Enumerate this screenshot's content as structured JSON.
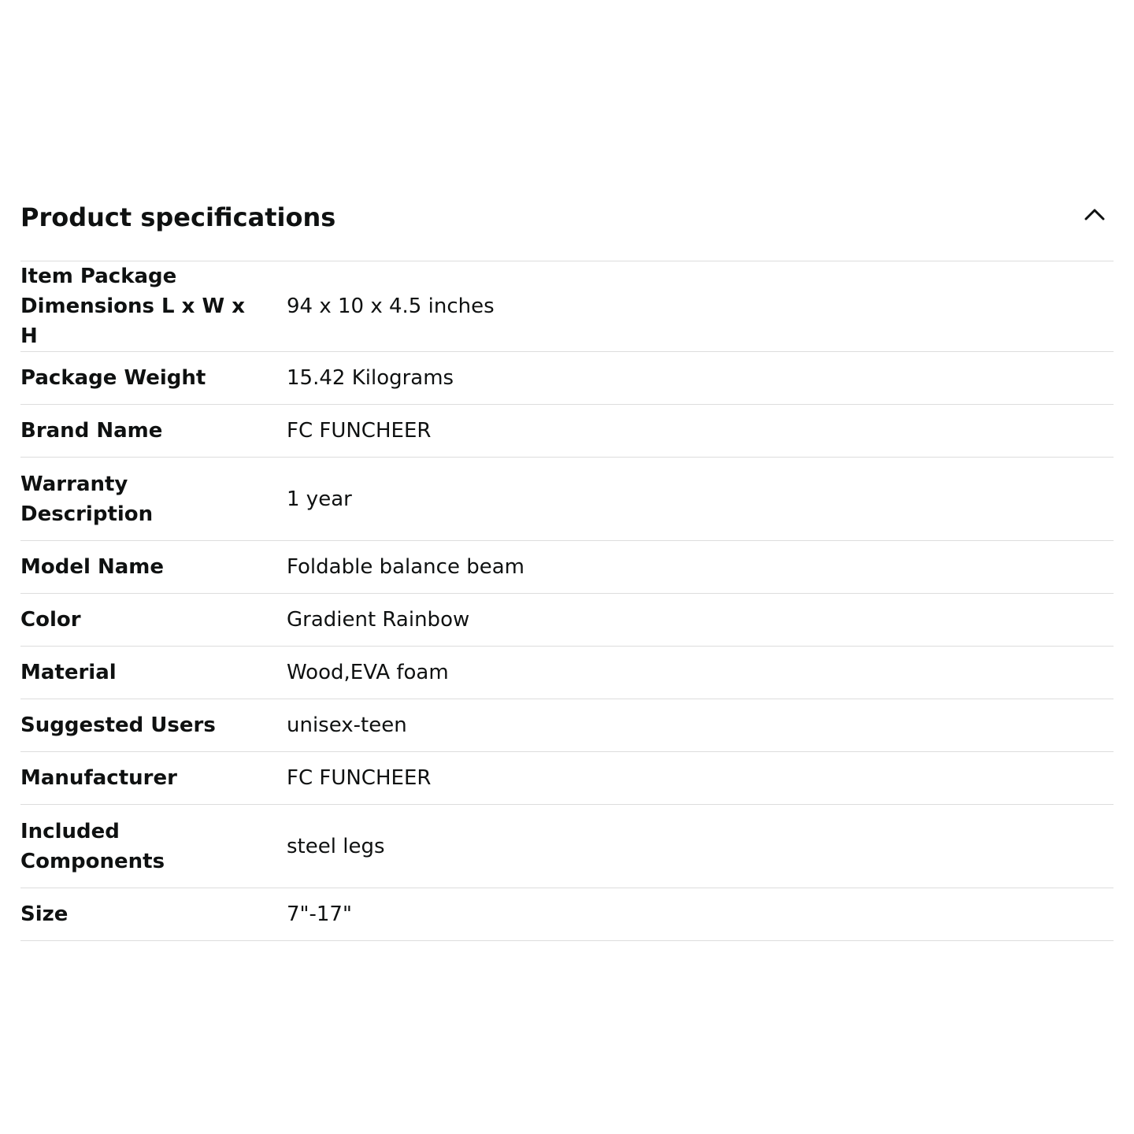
{
  "section": {
    "title": "Product specifications",
    "toggle_icon": "chevron-up-icon"
  },
  "specs": [
    {
      "label": "Item Package Dimensions L x W x H",
      "value": "94 x 10 x 4.5 inches"
    },
    {
      "label": "Package Weight",
      "value": "15.42 Kilograms"
    },
    {
      "label": "Brand Name",
      "value": "FC FUNCHEER"
    },
    {
      "label": "Warranty Description",
      "value": "1 year"
    },
    {
      "label": "Model Name",
      "value": "Foldable balance beam"
    },
    {
      "label": "Color",
      "value": "Gradient Rainbow"
    },
    {
      "label": "Material",
      "value": "Wood,EVA foam"
    },
    {
      "label": "Suggested Users",
      "value": "unisex-teen"
    },
    {
      "label": "Manufacturer",
      "value": "FC FUNCHEER"
    },
    {
      "label": "Included Components",
      "value": "steel legs"
    },
    {
      "label": "Size",
      "value": "7\"-17\""
    }
  ]
}
